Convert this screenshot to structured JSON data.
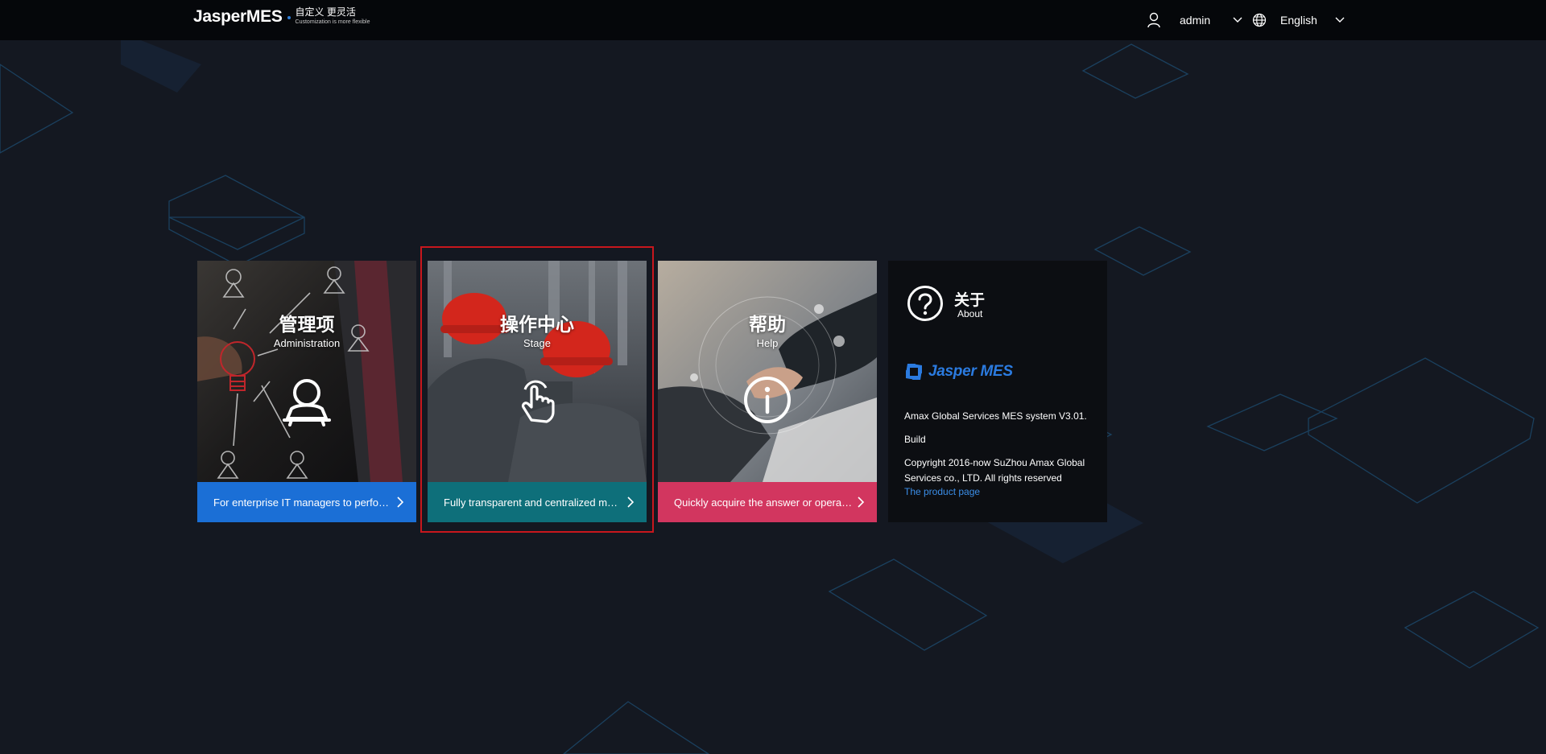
{
  "header": {
    "logo_main": "JasperMES",
    "logo_cn": "自定义 更灵活",
    "logo_en": "Customization is more flexible",
    "user_name": "admin",
    "language": "English"
  },
  "cards": [
    {
      "title": "管理项",
      "subtitle": "Administration",
      "footer": "For enterprise IT managers to perform system configuration",
      "footer_color": "#1b6fd6",
      "icon": "user-icon"
    },
    {
      "title": "操作中心",
      "subtitle": "Stage",
      "footer": "Fully transparent and centralized management",
      "footer_color": "#0e6f7a",
      "icon": "hand-pointer-icon",
      "selected": true
    },
    {
      "title": "帮助",
      "subtitle": "Help",
      "footer": "Quickly acquire the answer or operation guide",
      "footer_color": "#d2365f",
      "icon": "info-icon"
    }
  ],
  "about": {
    "title": "关于",
    "subtitle": "About",
    "logo_text": "Jasper MES",
    "system_line": "Amax Global Services MES system V3.01.",
    "build_line": "Build",
    "copyright": "Copyright 2016-now SuZhou Amax Global Services co., LTD. All rights reserved",
    "link": "The product page"
  },
  "colors": {
    "background": "#141821",
    "topbar": "#05070a",
    "selection_border": "#c8171d",
    "link": "#3b8ee8"
  }
}
